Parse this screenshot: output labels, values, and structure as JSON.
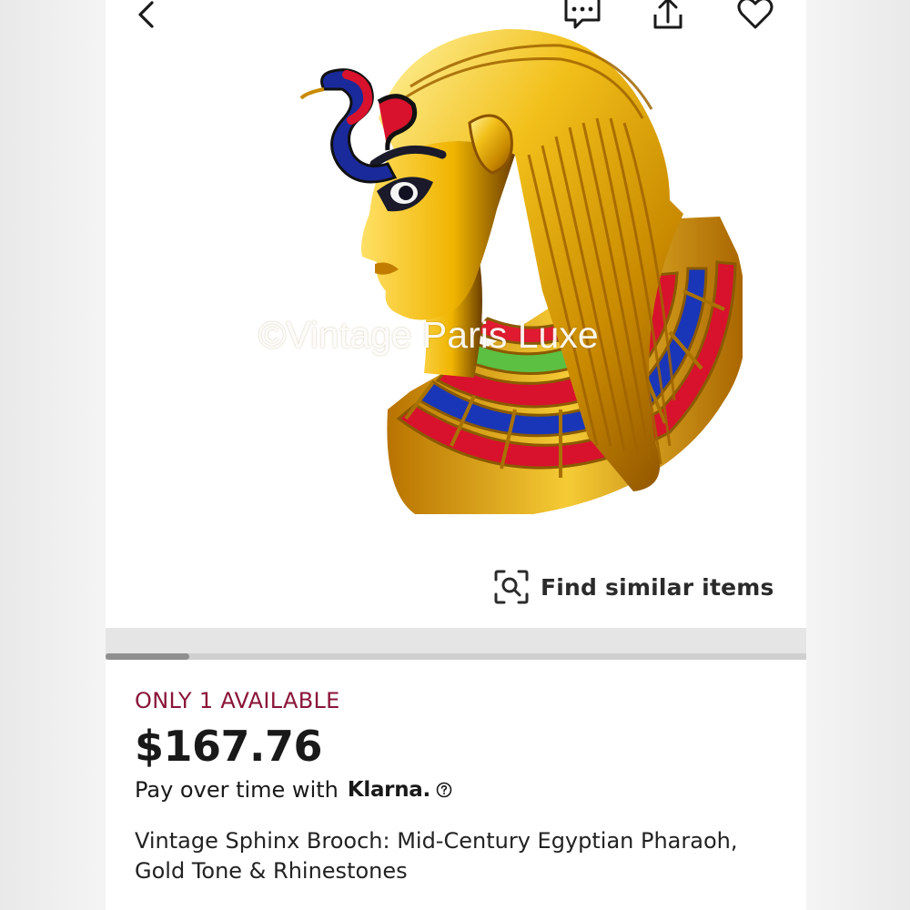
{
  "header": {
    "back_icon": "chevron-left-icon",
    "message_icon": "message-icon",
    "share_icon": "share-icon",
    "watch_icon": "heart-icon"
  },
  "gallery": {
    "image_subject": "Egyptian pharaoh brooch with gold tone and red, blue, green enamel collar",
    "watermark": "©Vintage Paris Luxe",
    "find_similar_label": "Find similar items",
    "find_similar_icon": "visual-search-icon",
    "scroll_position": 0.12
  },
  "listing": {
    "availability": "ONLY 1 AVAILABLE",
    "price": "$167.76",
    "pay_over_time": "Pay over time with",
    "klarna_brand": "Klarna.",
    "title": "Vintage Sphinx Brooch: Mid-Century Egyptian Pharaoh, Gold Tone & Rhinestones"
  },
  "colors": {
    "availability": "#8a1538",
    "gold": "#d9a300",
    "enamel_red": "#d8122c",
    "enamel_blue": "#1a36b8",
    "enamel_green": "#5cc043"
  }
}
